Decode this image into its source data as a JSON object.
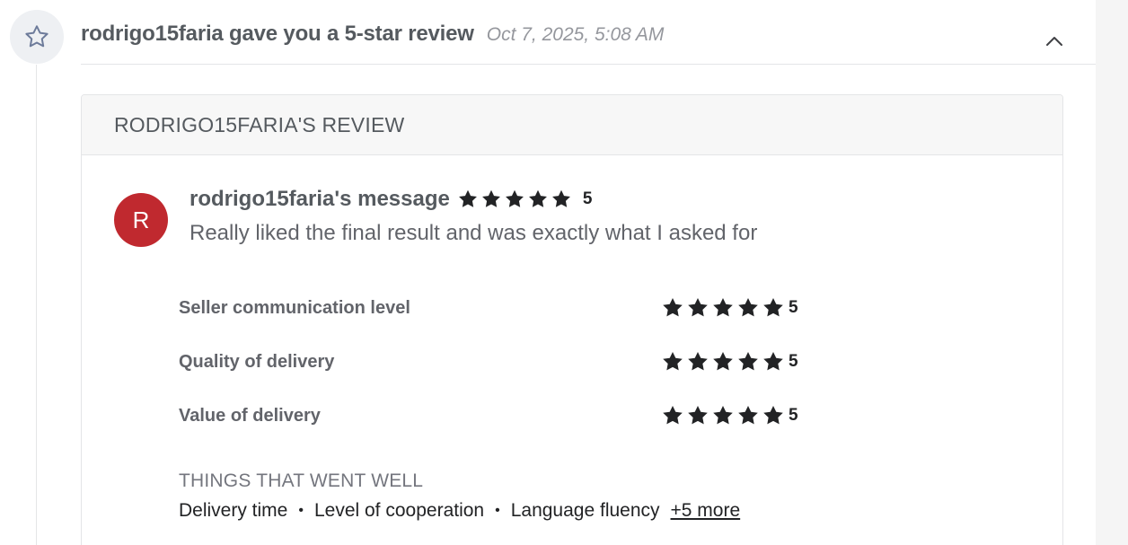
{
  "event": {
    "title": "rodrigo15faria gave you a 5-star review",
    "timestamp": "Oct 7, 2025, 5:08 AM",
    "icon": "star-outline-icon",
    "collapse_icon": "chevron-up-icon"
  },
  "review": {
    "header": "RODRIGO15FARIA'S REVIEW",
    "avatar_initial": "R",
    "avatar_color": "#c0292f",
    "author_label": "rodrigo15faria's message",
    "overall_rating": "5",
    "message": "Really liked the final result and was exactly what I asked for",
    "ratings": [
      {
        "label": "Seller communication level",
        "value": "5"
      },
      {
        "label": "Quality of delivery",
        "value": "5"
      },
      {
        "label": "Value of delivery",
        "value": "5"
      }
    ],
    "went_well_title": "THINGS THAT WENT WELL",
    "went_well_tags": [
      "Delivery time",
      "Level of cooperation",
      "Language fluency"
    ],
    "more_link": "+5 more"
  },
  "colors": {
    "star": "#222325",
    "icon_bg": "#eef0f3",
    "icon_stroke": "#6d7b9a"
  }
}
